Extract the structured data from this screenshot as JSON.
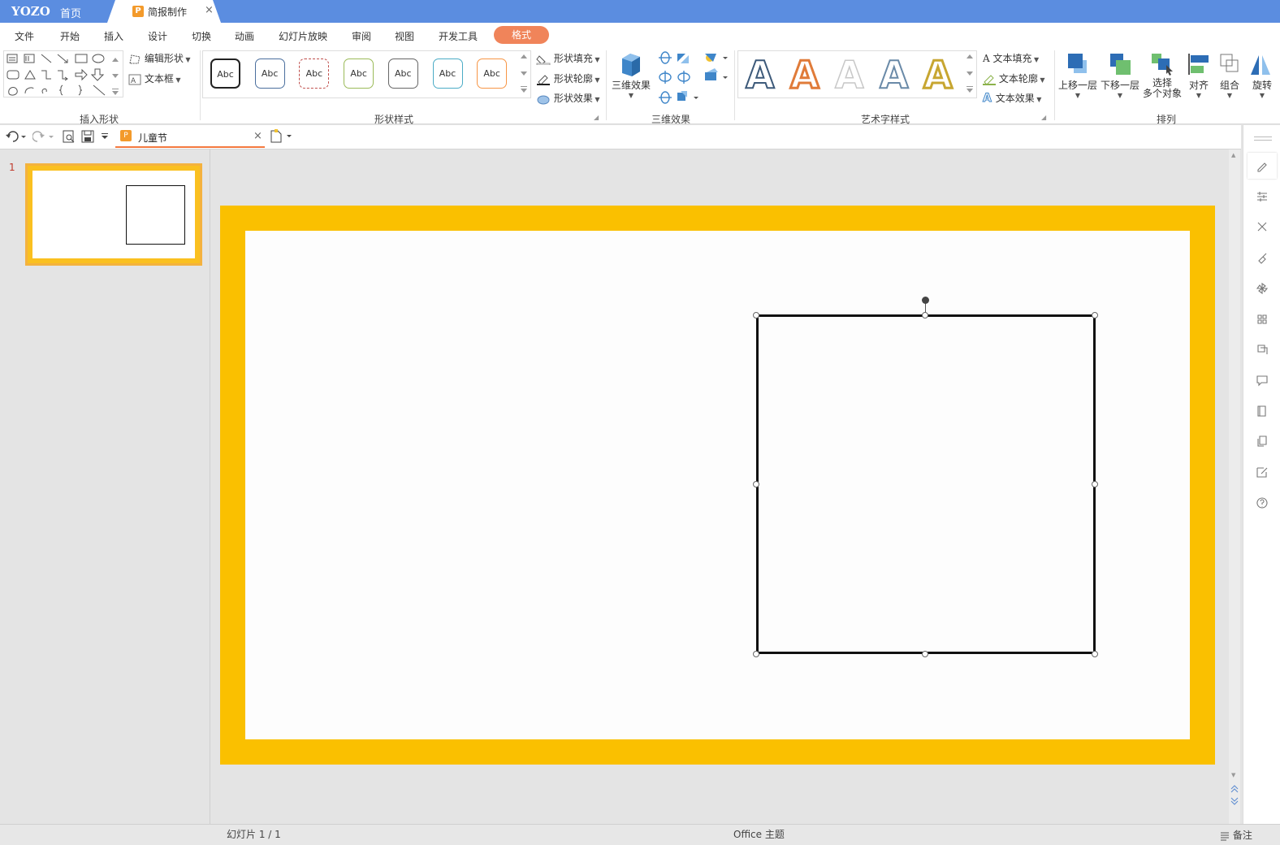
{
  "titlebar": {
    "brand": "YOZO",
    "home_tab": "首页",
    "doc_tab": "简报制作",
    "doc_tab_icon": "P",
    "close": "×"
  },
  "menu": {
    "items": [
      "文件",
      "开始",
      "插入",
      "设计",
      "切换",
      "动画",
      "幻灯片放映",
      "审阅",
      "视图",
      "开发工具"
    ],
    "active": "格式"
  },
  "ribbon": {
    "insert_shapes": {
      "label": "插入形状",
      "edit_shape": "编辑形状",
      "textbox": "文本框"
    },
    "shape_styles": {
      "label": "形状样式",
      "preset": "Abc",
      "colors": [
        "#222222",
        "#4b6f9e",
        "#c0504d",
        "#9bbb59",
        "#666666",
        "#4bacc6",
        "#f79646"
      ],
      "fill": "形状填充",
      "outline": "形状轮廓",
      "effects": "形状效果"
    },
    "threed": {
      "label": "三维效果",
      "button": "三维效果"
    },
    "wordart": {
      "label": "艺术字样式",
      "glyph": "A",
      "text_fill": "文本填充",
      "text_outline": "文本轮廓",
      "text_effects": "文本效果"
    },
    "arrange": {
      "label": "排列",
      "bring_forward": "上移一层",
      "send_backward": "下移一层",
      "select_line1": "选择",
      "select_line2": "多个对象",
      "align": "对齐",
      "group": "组合",
      "rotate": "旋转"
    }
  },
  "quickbar": {
    "doc_name": "儿童节"
  },
  "slides_panel": {
    "slide_number": "1"
  },
  "status": {
    "slide_counter": "幻灯片 1 / 1",
    "theme": "Office 主题",
    "notes": "备注"
  },
  "colors": {
    "titlebar": "#5b8de0",
    "accent_tab": "#f0845a",
    "slide_border": "#fac000",
    "thumb_border": "#f4b23e"
  },
  "sidebar_icons": [
    "pencil-icon",
    "sliders-icon",
    "scissors-icon",
    "brush-icon",
    "pinwheel-icon",
    "grid-icon",
    "crop-icon",
    "comment-icon",
    "book-icon",
    "copy-icon",
    "edit-icon",
    "help-icon"
  ]
}
